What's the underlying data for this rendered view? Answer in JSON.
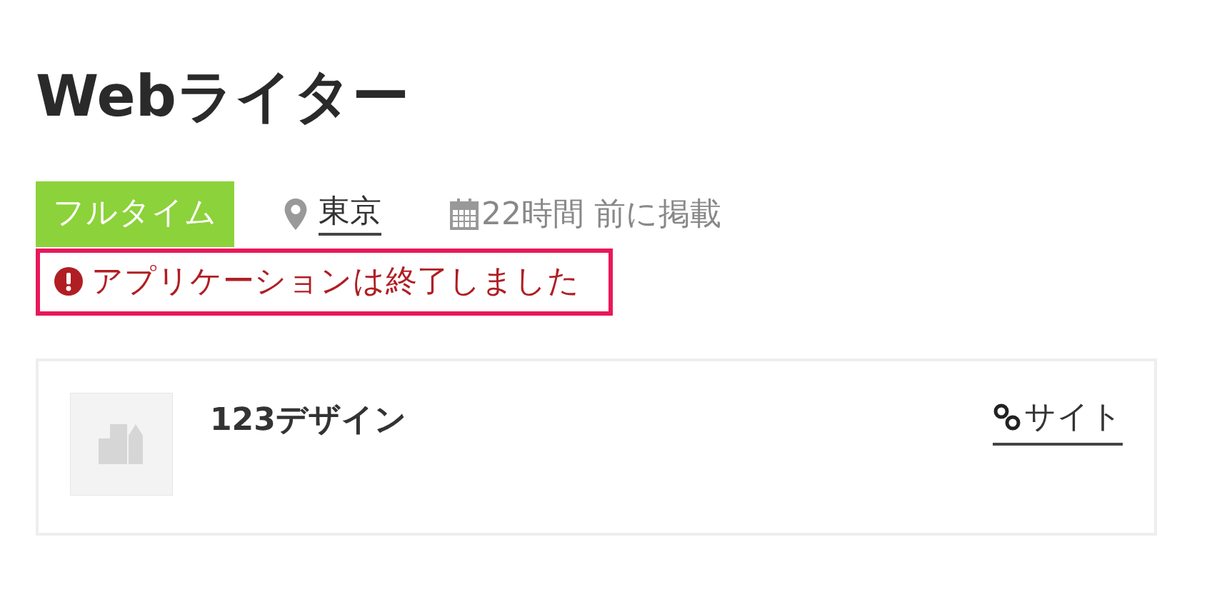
{
  "title": "Webライター",
  "meta": {
    "job_type": "フルタイム",
    "location": "東京",
    "posted": "22時間 前に掲載"
  },
  "alert": {
    "message": "アプリケーションは終了しました"
  },
  "company": {
    "name": "123デザイン",
    "link": "サイト"
  }
}
